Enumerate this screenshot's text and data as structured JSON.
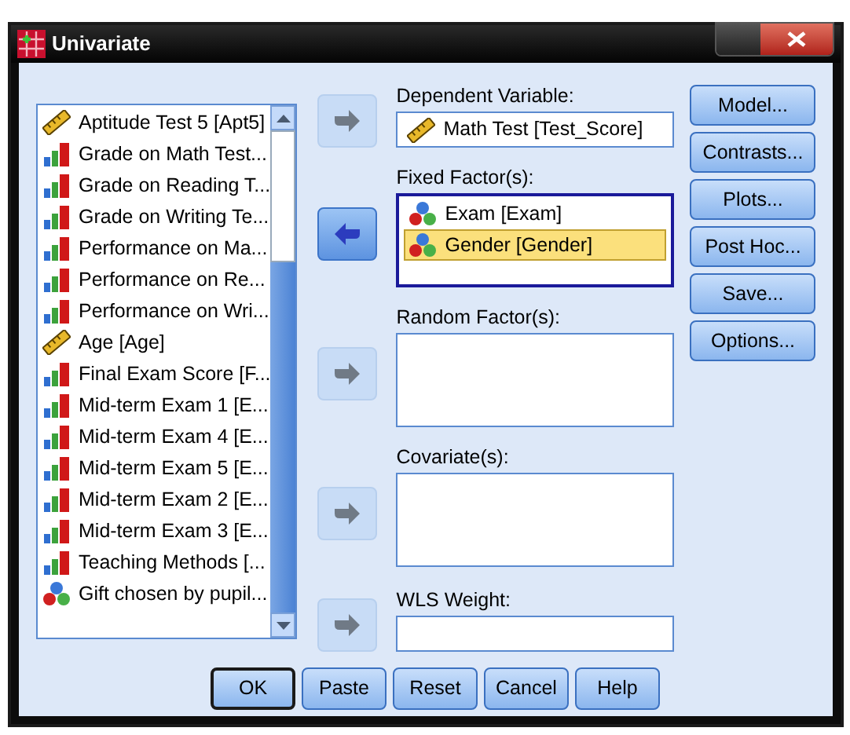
{
  "window": {
    "title": "Univariate"
  },
  "variables": [
    {
      "label": "Aptitude Test 5 [Apt5]",
      "kind": "scale"
    },
    {
      "label": "Grade on Math Test...",
      "kind": "ordinal"
    },
    {
      "label": "Grade on Reading T...",
      "kind": "ordinal"
    },
    {
      "label": "Grade on Writing Te...",
      "kind": "ordinal"
    },
    {
      "label": "Performance on Ma...",
      "kind": "ordinal"
    },
    {
      "label": "Performance on Re...",
      "kind": "ordinal"
    },
    {
      "label": "Performance on Wri...",
      "kind": "ordinal"
    },
    {
      "label": "Age [Age]",
      "kind": "scale"
    },
    {
      "label": "Final Exam Score [F...",
      "kind": "ordinal"
    },
    {
      "label": "Mid-term Exam 1 [E...",
      "kind": "ordinal"
    },
    {
      "label": "Mid-term Exam 4 [E...",
      "kind": "ordinal"
    },
    {
      "label": "Mid-term Exam 5 [E...",
      "kind": "ordinal"
    },
    {
      "label": "Mid-term Exam 2 [E...",
      "kind": "ordinal"
    },
    {
      "label": "Mid-term Exam 3 [E...",
      "kind": "ordinal"
    },
    {
      "label": "Teaching Methods [...",
      "kind": "ordinal"
    },
    {
      "label": "Gift chosen by pupil...",
      "kind": "nominal"
    }
  ],
  "target_lists": [
    {
      "label": "Dependent Variable:",
      "kind": "field",
      "arrow": {
        "kind": "add",
        "disabled": true
      },
      "items": [
        {
          "label": "Math Test [Test_Score]",
          "kind": "scale",
          "selected": false
        }
      ]
    },
    {
      "label": "Fixed Factor(s):",
      "kind": "list",
      "focused": true,
      "arrow": {
        "kind": "remove",
        "disabled": false
      },
      "items": [
        {
          "label": "Exam [Exam]",
          "kind": "nominal",
          "selected": false
        },
        {
          "label": "Gender [Gender]",
          "kind": "nominal",
          "selected": true
        }
      ]
    },
    {
      "label": "Random Factor(s):",
      "kind": "list",
      "focused": false,
      "arrow": {
        "kind": "add",
        "disabled": true
      }
    },
    {
      "label": "Covariate(s):",
      "kind": "list",
      "focused": false,
      "arrow": {
        "kind": "add",
        "disabled": true
      }
    },
    {
      "label": "WLS Weight:",
      "kind": "field",
      "arrow": {
        "kind": "add",
        "disabled": true
      }
    }
  ],
  "side_buttons": [
    "Model...",
    "Contrasts...",
    "Plots...",
    "Post Hoc...",
    "Save...",
    "Options..."
  ],
  "bottom_buttons": [
    {
      "label": "OK",
      "default": true
    },
    {
      "label": "Paste",
      "default": false
    },
    {
      "label": "Reset",
      "default": false
    },
    {
      "label": "Cancel",
      "default": false
    },
    {
      "label": "Help",
      "default": false
    }
  ]
}
